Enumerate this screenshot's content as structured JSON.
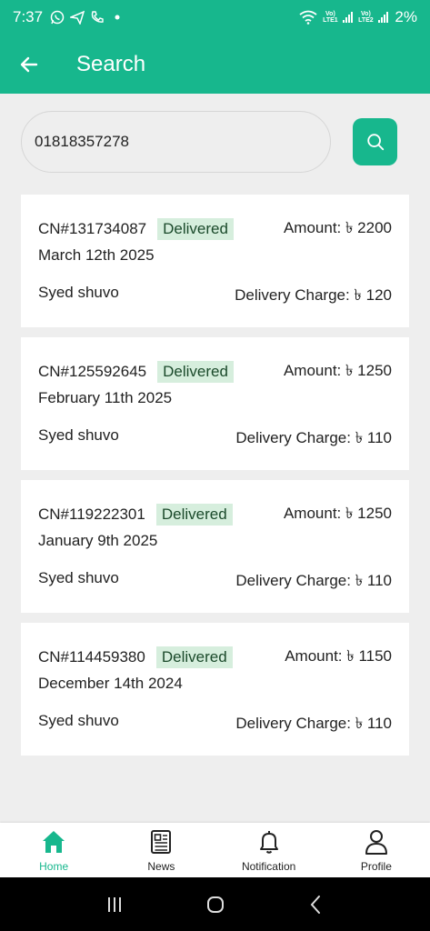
{
  "status_bar": {
    "time": "7:37",
    "lte1": "Vo) LTE1",
    "lte2": "Vo) LTE2",
    "battery": "2%"
  },
  "appbar": {
    "title": "Search"
  },
  "search": {
    "value": "01818357278",
    "placeholder": ""
  },
  "orders": [
    {
      "cn": "CN#131734087",
      "status": "Delivered",
      "amount": "Amount: ৳ 2200",
      "date": "March 12th 2025",
      "customer": "Syed shuvo",
      "charge": "Delivery Charge: ৳ 120"
    },
    {
      "cn": "CN#125592645",
      "status": "Delivered",
      "amount": "Amount: ৳ 1250",
      "date": "February 11th 2025",
      "customer": "Syed shuvo",
      "charge": "Delivery Charge: ৳ 110"
    },
    {
      "cn": "CN#119222301",
      "status": "Delivered",
      "amount": "Amount: ৳ 1250",
      "date": "January 9th 2025",
      "customer": "Syed shuvo",
      "charge": "Delivery Charge: ৳ 110"
    },
    {
      "cn": "CN#114459380",
      "status": "Delivered",
      "amount": "Amount: ৳ 1150",
      "date": "December 14th 2024",
      "customer": "Syed shuvo",
      "charge": "Delivery Charge: ৳ 110"
    }
  ],
  "bottom_nav": {
    "items": [
      {
        "label": "Home",
        "icon": "home-icon",
        "active": true
      },
      {
        "label": "News",
        "icon": "news-icon",
        "active": false
      },
      {
        "label": "Notification",
        "icon": "bell-icon",
        "active": false
      },
      {
        "label": "Profile",
        "icon": "user-icon",
        "active": false
      }
    ]
  },
  "colors": {
    "accent": "#17b78d",
    "badge_bg": "#d6eedd",
    "background": "#eeeeee"
  }
}
